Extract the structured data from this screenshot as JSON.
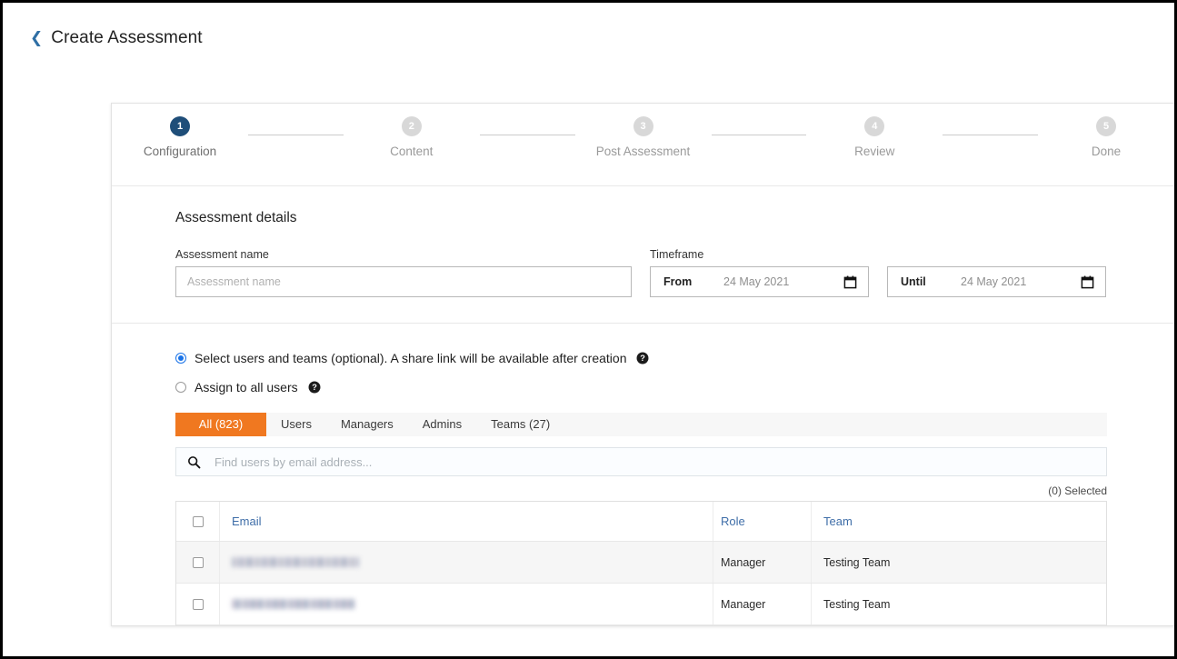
{
  "header": {
    "back_label": "Create Assessment",
    "back_icon": "chevron-left-icon"
  },
  "stepper": {
    "steps": [
      {
        "number": "1",
        "label": "Configuration",
        "active": true
      },
      {
        "number": "2",
        "label": "Content",
        "active": false
      },
      {
        "number": "3",
        "label": "Post Assessment",
        "active": false
      },
      {
        "number": "4",
        "label": "Review",
        "active": false
      },
      {
        "number": "5",
        "label": "Done",
        "active": false
      }
    ],
    "active_color": "#1f4e79",
    "inactive_color": "#d8d8d8"
  },
  "details": {
    "title": "Assessment details",
    "name_label": "Assessment name",
    "name_placeholder": "Assessment name",
    "name_value": "",
    "timeframe_label": "Timeframe",
    "from_prefix": "From",
    "from_value": "24 May 2021",
    "until_prefix": "Until",
    "until_value": "24 May 2021",
    "calendar_icon": "calendar-icon"
  },
  "audience": {
    "option_select": "Select users and teams (optional). A share link will be available after creation",
    "option_all": "Assign to all users",
    "selected_option": "select",
    "help_icon": "help-circle-icon",
    "radio_accent": "#1a73e8"
  },
  "tabs": {
    "accent": "#f07820",
    "items": [
      {
        "label": "All (823)",
        "active": true
      },
      {
        "label": "Users",
        "active": false
      },
      {
        "label": "Managers",
        "active": false
      },
      {
        "label": "Admins",
        "active": false
      },
      {
        "label": "Teams (27)",
        "active": false
      }
    ]
  },
  "search": {
    "placeholder": "Find users by email address...",
    "value": "",
    "icon": "search-icon"
  },
  "table": {
    "selected_text": "(0) Selected",
    "columns": [
      "Email",
      "Role",
      "Team"
    ],
    "rows": [
      {
        "email": "",
        "email_redacted": true,
        "role": "Manager",
        "team": "Testing Team",
        "shaded": true
      },
      {
        "email": "",
        "email_redacted": true,
        "role": "Manager",
        "team": "Testing Team",
        "shaded": false
      }
    ]
  }
}
